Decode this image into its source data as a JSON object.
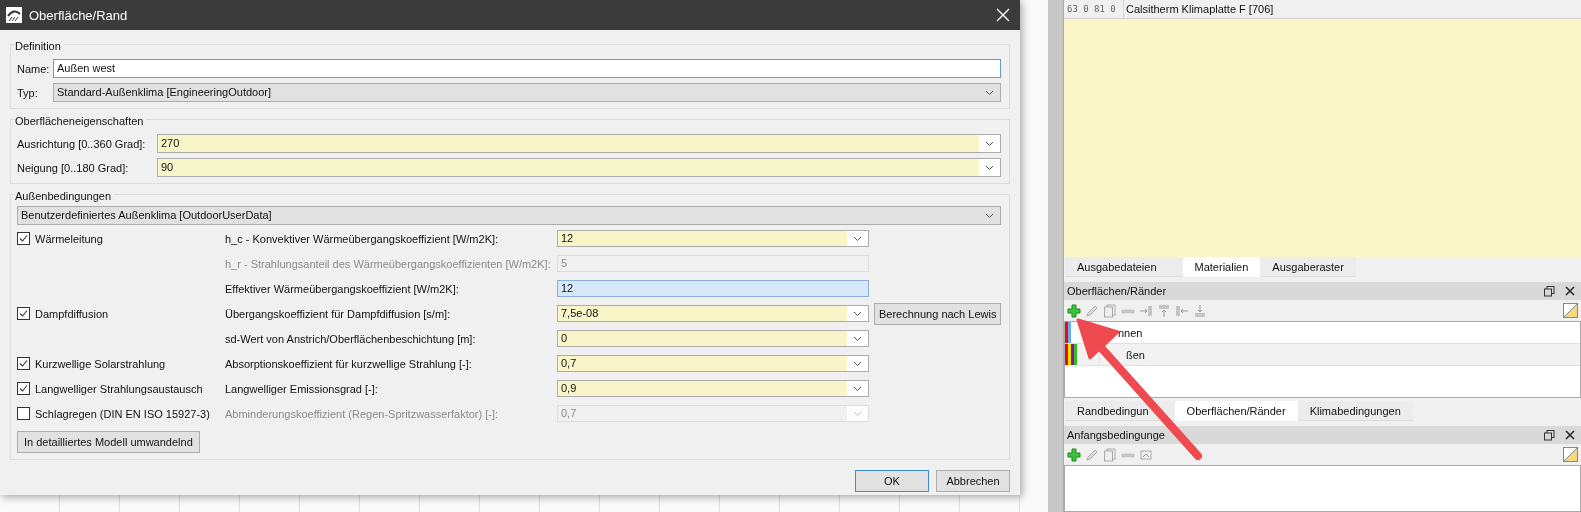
{
  "dialog": {
    "title": "Oberfläche/Rand",
    "definition": {
      "title": "Definition",
      "name": {
        "label": "Name:",
        "value": "Außen west"
      },
      "type": {
        "label": "Typ:",
        "value": "Standard-Außenklima [EngineeringOutdoor]"
      }
    },
    "surface_properties": {
      "title": "Oberflächeneigenschaften",
      "fields": [
        {
          "label": "Ausrichtung [0..360 Grad]:",
          "value": "270"
        },
        {
          "label": "Neigung [0..180 Grad]:",
          "value": "90"
        }
      ]
    },
    "outdoor_conditions": {
      "title": "Außenbedingungen",
      "climate_model": "Benutzerdefiniertes Außenklima [OutdoorUserData]",
      "rows": [
        {
          "checkbox": {
            "label": "Wärmeleitung",
            "checked": true
          },
          "label": "h_c - Konvektiver Wärmeübergangskoeffizient [W/m2K]:",
          "value": "12",
          "kind": "combo",
          "disabled": false
        },
        {
          "label": "h_r - Strahlungsanteil des Wärmeübergangskoeffizienten [W/m2K]:",
          "value": "5",
          "kind": "readonly",
          "disabled": true
        },
        {
          "label": "Effektiver Wärmeübergangskoeffizient [W/m2K]:",
          "value": "12",
          "kind": "result",
          "disabled": false
        },
        {
          "checkbox": {
            "label": "Dampfdiffusion",
            "checked": true
          },
          "label": "Übergangskoeffizient für Dampfdiffusion [s/m]:",
          "value": "7,5e-08",
          "kind": "combo",
          "disabled": false,
          "button": "Berechnung nach Lewis"
        },
        {
          "label": "sd-Wert von Anstrich/Oberflächenbeschichtung [m]:",
          "value": "0",
          "kind": "combo",
          "disabled": false
        },
        {
          "checkbox": {
            "label": "Kurzwellige Solarstrahlung",
            "checked": true
          },
          "label": "Absorptionskoeffizient für kurzwellige Strahlung [-]:",
          "value": "0,7",
          "kind": "combo",
          "disabled": false
        },
        {
          "checkbox": {
            "label": "Langwelliger Strahlungsaustausch",
            "checked": true
          },
          "label": "Langwelliger Emissionsgrad [-]:",
          "value": "0,9",
          "kind": "combo",
          "disabled": false
        },
        {
          "checkbox": {
            "label": "Schlagregen (DIN EN ISO 15927-3)",
            "checked": false
          },
          "label": "Abminderungskoeffizient (Regen-Spritzwasserfaktor) [-]:",
          "value": "0,7",
          "kind": "combo",
          "disabled": true
        }
      ],
      "convert_button": "In detailliertes Modell umwandelnd"
    },
    "buttons": [
      {
        "label": "OK",
        "default": true
      },
      {
        "label": "Abbrechen",
        "default": false
      }
    ]
  },
  "material_row": {
    "numbers": "63 0 81 0",
    "name": "Calsitherm Klimaplatte F [706]"
  },
  "tabs_top": [
    {
      "label": "Ausgabedateien",
      "selected": false
    },
    {
      "label": "Materialien",
      "selected": true
    },
    {
      "label": "Ausgaberaster",
      "selected": false
    }
  ],
  "surfaces_panel": {
    "title": "Oberflächen/Ränder",
    "items": [
      {
        "label": "nnen",
        "stripes": [
          {
            "color": "#e01010"
          },
          {
            "color": "#6aa8f0"
          }
        ]
      },
      {
        "label": "ßen",
        "stripes": [
          {
            "color": "#e01010"
          },
          {
            "color": "#f0e000"
          },
          {
            "color": "#8a10a8"
          },
          {
            "color": "#30c020"
          }
        ]
      }
    ]
  },
  "tabs_bottom": [
    {
      "label": "Randbedingun",
      "selected": false
    },
    {
      "label": "Oberflächen/Ränder",
      "selected": true
    },
    {
      "label": "Klimabedingungen",
      "selected": false
    }
  ],
  "initial_panel": {
    "title": "Anfangsbedingunge"
  }
}
